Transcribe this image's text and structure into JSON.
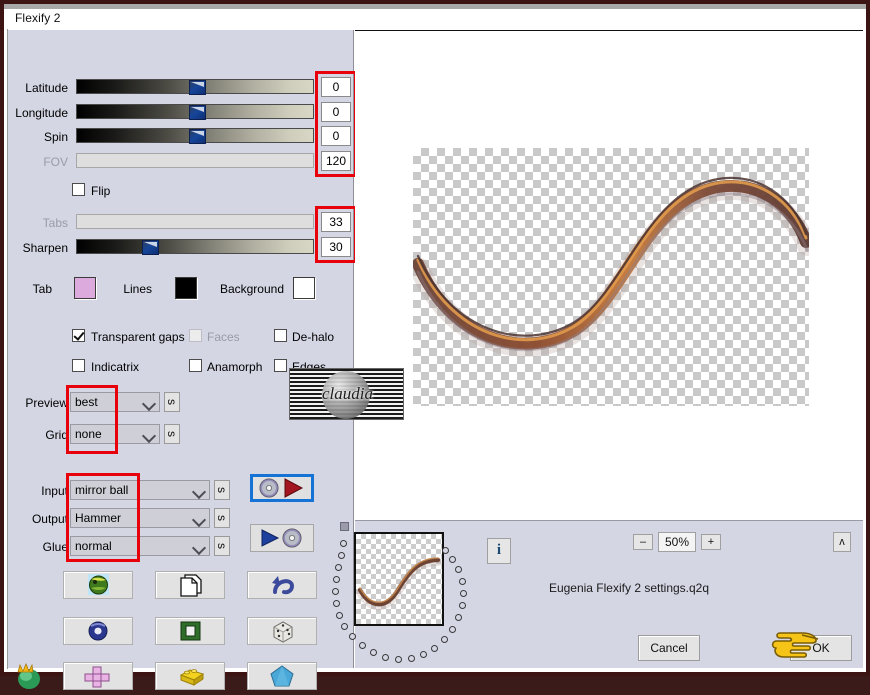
{
  "window": {
    "title": "Flexify 2"
  },
  "sliders": [
    {
      "label": "Latitude",
      "value": "0",
      "disabled": false,
      "pos": 0.5
    },
    {
      "label": "Longitude",
      "value": "0",
      "disabled": false,
      "pos": 0.5
    },
    {
      "label": "Spin",
      "value": "0",
      "disabled": false,
      "pos": 0.5
    },
    {
      "label": "FOV",
      "value": "120",
      "disabled": true,
      "pos": 0.5
    }
  ],
  "flip": {
    "label": "Flip",
    "checked": false
  },
  "sliders2": [
    {
      "label": "Tabs",
      "value": "33",
      "disabled": true,
      "pos": 0.5
    },
    {
      "label": "Sharpen",
      "value": "30",
      "disabled": false,
      "pos": 0.3
    }
  ],
  "colors": {
    "tab": {
      "label": "Tab",
      "hex": "#dcaadd"
    },
    "lines": {
      "label": "Lines",
      "hex": "#000000"
    },
    "background": {
      "label": "Background",
      "hex": "#ffffff"
    }
  },
  "checkboxes": [
    {
      "label": "Transparent gaps",
      "checked": true,
      "disabled": false
    },
    {
      "label": "Faces",
      "checked": false,
      "disabled": true
    },
    {
      "label": "De-halo",
      "checked": false,
      "disabled": false
    },
    {
      "label": "Indicatrix",
      "checked": false,
      "disabled": false
    },
    {
      "label": "Anamorph",
      "checked": false,
      "disabled": false
    },
    {
      "label": "Edges",
      "checked": false,
      "disabled": false
    }
  ],
  "selects": [
    {
      "label": "Preview",
      "value": "best",
      "side_button": "s"
    },
    {
      "label": "Grid",
      "value": "none",
      "side_button": "s"
    },
    {
      "label": "Input",
      "value": "mirror ball",
      "side_button": "s"
    },
    {
      "label": "Output",
      "value": "Hammer",
      "side_button": "s"
    },
    {
      "label": "Glue",
      "value": "normal",
      "side_button": "s"
    }
  ],
  "transfer_buttons": [
    {
      "name": "load-settings",
      "icon": "disc-arrow-icon",
      "selected": true
    },
    {
      "name": "save-settings",
      "icon": "arrow-disc-icon",
      "selected": false
    }
  ],
  "projection_buttons": [
    {
      "name": "sphere-preset",
      "icon": "green-sphere-icon"
    },
    {
      "name": "pages-preset",
      "icon": "pages-icon"
    },
    {
      "name": "undo-preset",
      "icon": "undo-arrow-icon"
    },
    {
      "name": "torus-preset",
      "icon": "blue-torus-icon"
    },
    {
      "name": "frame-preset",
      "icon": "green-frame-icon"
    },
    {
      "name": "dice-preset",
      "icon": "dice-icon"
    },
    {
      "name": "cross-preset",
      "icon": "pink-cross-icon"
    },
    {
      "name": "brick-preset",
      "icon": "yellow-brick-icon"
    },
    {
      "name": "pentagon-preset",
      "icon": "blue-pentagon-icon"
    }
  ],
  "corner_icon": {
    "name": "flexify-logo-icon"
  },
  "status": {
    "info_button": "i",
    "zoom_out": "–",
    "zoom_level": "50%",
    "zoom_in": "+",
    "collapse_button": "ʌ",
    "filename": "Eugenia Flexify 2 settings.q2q"
  },
  "dialog_buttons": {
    "cancel": "Cancel",
    "ok": "OK"
  },
  "cursor": {
    "name": "pointing-hand-cursor"
  },
  "watermark": {
    "text": "claudia"
  },
  "highlights": {
    "color": "#e8000b",
    "regions": [
      "value-boxes-top",
      "value-boxes-mid",
      "preview-grid-selects",
      "io-selects"
    ]
  }
}
